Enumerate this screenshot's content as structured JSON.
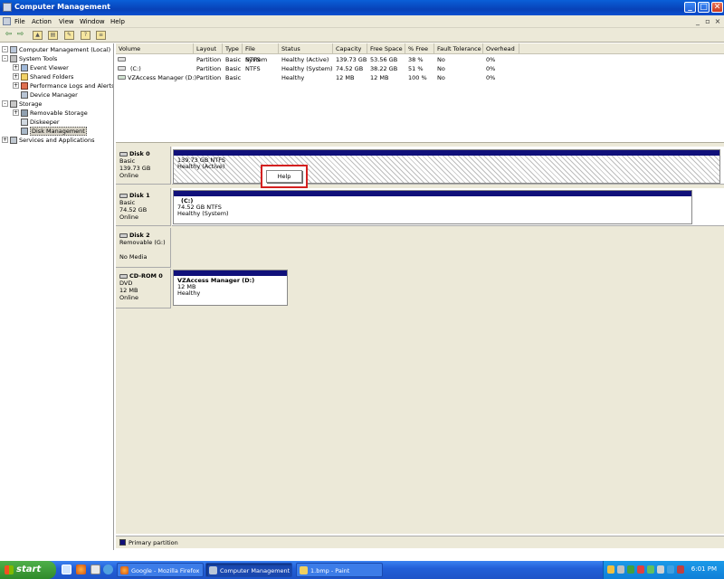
{
  "window": {
    "title": "Computer Management",
    "controls": [
      "_",
      "□",
      "✕"
    ]
  },
  "menu": [
    "File",
    "Action",
    "View",
    "Window",
    "Help"
  ],
  "tree": [
    {
      "label": "Computer Management (Local)",
      "level": 0,
      "expander": "-"
    },
    {
      "label": "System Tools",
      "level": 1,
      "expander": "-"
    },
    {
      "label": "Event Viewer",
      "level": 2,
      "expander": "+"
    },
    {
      "label": "Shared Folders",
      "level": 2,
      "expander": "+"
    },
    {
      "label": "Performance Logs and Alerts",
      "level": 2,
      "expander": "+"
    },
    {
      "label": "Device Manager",
      "level": 2,
      "expander": ""
    },
    {
      "label": "Storage",
      "level": 1,
      "expander": "-"
    },
    {
      "label": "Removable Storage",
      "level": 2,
      "expander": "+"
    },
    {
      "label": "Diskeeper",
      "level": 2,
      "expander": ""
    },
    {
      "label": "Disk Management",
      "level": 2,
      "expander": "",
      "selected": true
    },
    {
      "label": "Services and Applications",
      "level": 1,
      "expander": "+"
    }
  ],
  "volumes": {
    "columns": [
      "Volume",
      "Layout",
      "Type",
      "File System",
      "Status",
      "Capacity",
      "Free Space",
      "% Free",
      "Fault Tolerance",
      "Overhead"
    ],
    "rows": [
      [
        "",
        "Partition",
        "Basic",
        "NTFS",
        "Healthy (Active)",
        "139.73 GB",
        "53.56 GB",
        "38 %",
        "No",
        "0%"
      ],
      [
        "(C:)",
        "Partition",
        "Basic",
        "NTFS",
        "Healthy (System)",
        "74.52 GB",
        "38.22 GB",
        "51 %",
        "No",
        "0%"
      ],
      [
        "VZAccess Manager (D:)",
        "Partition",
        "Basic",
        "",
        "Healthy",
        "12 MB",
        "12 MB",
        "100 %",
        "No",
        "0%"
      ]
    ]
  },
  "disks": [
    {
      "name": "Disk 0",
      "lines": [
        "Basic",
        "139.73 GB",
        "Online"
      ],
      "part_title": "",
      "part_lines": [
        "139.73 GB NTFS",
        "Healthy (Active)"
      ]
    },
    {
      "name": "Disk 1",
      "lines": [
        "Basic",
        "74.52 GB",
        "Online"
      ],
      "part_title": "(C:)",
      "part_lines": [
        "74.52 GB NTFS",
        "Healthy (System)"
      ]
    },
    {
      "name": "Disk 2",
      "lines": [
        "Removable (G:)",
        "",
        "No Media"
      ],
      "part_title": "",
      "part_lines": []
    },
    {
      "name": "CD-ROM 0",
      "lines": [
        "DVD",
        "12 MB",
        "Online"
      ],
      "part_title": "VZAccess Manager  (D:)",
      "part_lines": [
        "12 MB",
        "Healthy"
      ]
    }
  ],
  "popup": {
    "label": "Help"
  },
  "legend": {
    "label": "Primary partition",
    "color": "#10107a"
  },
  "taskbar": {
    "start": "start",
    "tasks": [
      "Google - Mozilla Firefox",
      "Computer Management",
      "1.bmp - Paint"
    ],
    "clock": "6:01 PM"
  }
}
